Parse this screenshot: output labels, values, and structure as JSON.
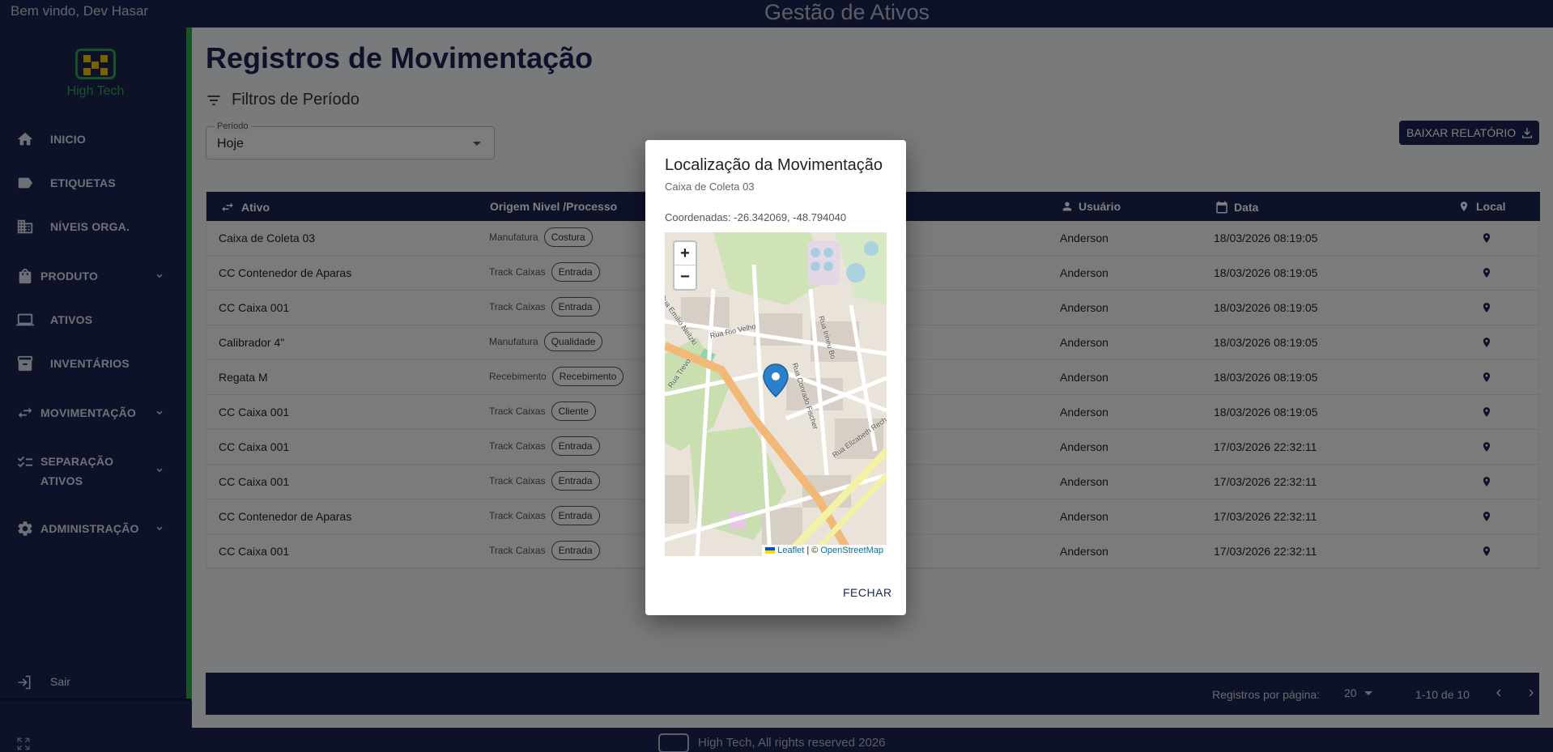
{
  "topbar": {
    "welcome": "Bem vindo, Dev Hasar",
    "app_title": "Gestão de Ativos"
  },
  "sidebar": {
    "logo_text": "High Tech",
    "items": [
      {
        "label": "INICIO",
        "icon": "home-icon",
        "has_chevron": false
      },
      {
        "label": "ETIQUETAS",
        "icon": "label-icon",
        "has_chevron": false
      },
      {
        "label": "NÍVEIS ORGA.",
        "icon": "building-icon",
        "has_chevron": false
      },
      {
        "label": "PRODUTO",
        "icon": "bag-icon",
        "has_chevron": true
      },
      {
        "label": "ATIVOS",
        "icon": "laptop-icon",
        "has_chevron": false
      },
      {
        "label": "INVENTÁRIOS",
        "icon": "archive-icon",
        "has_chevron": false
      },
      {
        "label": "MOVIMENTAÇÃO",
        "icon": "swap-icon",
        "has_chevron": true
      },
      {
        "label_line1": "SEPARAÇÃO",
        "label_line2": "ATIVOS",
        "icon": "checklist-icon",
        "has_chevron": true
      },
      {
        "label": "ADMINISTRAÇÃO",
        "icon": "gear-icon",
        "has_chevron": true
      }
    ],
    "logout": "Sair"
  },
  "main": {
    "page_title": "Registros de Movimentação",
    "filters_label": "Filtros de Período",
    "period": {
      "legend": "Período",
      "value": "Hoje"
    },
    "report_button": "BAIXAR RELATÓRIO",
    "table": {
      "headers": {
        "ativo": "Ativo",
        "origem": "Origem Nivel /Processo",
        "usuario": "Usuário",
        "data": "Data",
        "local": "Local"
      },
      "rows": [
        {
          "ativo": "Caixa de Coleta 03",
          "nivel": "Manufatura",
          "processo": "Costura",
          "usuario": "Anderson",
          "data": "18/03/2026 08:19:05"
        },
        {
          "ativo": "CC Contenedor de Aparas",
          "nivel": "Track Caixas",
          "processo": "Entrada",
          "usuario": "Anderson",
          "data": "18/03/2026 08:19:05"
        },
        {
          "ativo": "CC Caixa 001",
          "nivel": "Track Caixas",
          "processo": "Entrada",
          "usuario": "Anderson",
          "data": "18/03/2026 08:19:05"
        },
        {
          "ativo": "Calibrador 4\"",
          "nivel": "Manufatura",
          "processo": "Qualidade",
          "usuario": "Anderson",
          "data": "18/03/2026 08:19:05"
        },
        {
          "ativo": "Regata M",
          "nivel": "Recebimento",
          "processo": "Recebimento",
          "usuario": "Anderson",
          "data": "18/03/2026 08:19:05"
        },
        {
          "ativo": "CC Caixa 001",
          "nivel": "Track Caixas",
          "processo": "Cliente",
          "usuario": "Anderson",
          "data": "18/03/2026 08:19:05"
        },
        {
          "ativo": "CC Caixa 001",
          "nivel": "Track Caixas",
          "processo": "Entrada",
          "usuario": "Anderson",
          "data": "17/03/2026 22:32:11"
        },
        {
          "ativo": "CC Caixa 001",
          "nivel": "Track Caixas",
          "processo": "Entrada",
          "usuario": "Anderson",
          "data": "17/03/2026 22:32:11"
        },
        {
          "ativo": "CC Contenedor de Aparas",
          "nivel": "Track Caixas",
          "processo": "Entrada",
          "usuario": "Anderson",
          "data": "17/03/2026 22:32:11"
        },
        {
          "ativo": "CC Caixa 001",
          "nivel": "Track Caixas",
          "processo": "Entrada",
          "usuario": "Anderson",
          "data": "17/03/2026 22:32:11"
        }
      ]
    },
    "pagination": {
      "rows_per_page_label": "Registros por página:",
      "rows_per_page": "20",
      "range": "1-10 de 10"
    }
  },
  "footer": {
    "text": "High Tech, All rights reserved 2026"
  },
  "dialog": {
    "title": "Localização da Movimentação",
    "subtitle": "Caixa de Coleta 03",
    "coords": "Coordenadas: -26.342069, -48.794040",
    "map": {
      "zoom_in": "+",
      "zoom_out": "−",
      "attribution_leaflet": "Leaflet",
      "attribution_sep": "| ©",
      "attribution_osm": "OpenStreetMap",
      "streets": [
        "Rua Emílio Neitzki",
        "Rua Rio Velho",
        "Rua Trevo",
        "Rua Conrado Fischer",
        "Rua Elizabeth Rech",
        "Rua Irineu Bo"
      ]
    },
    "close": "FECHAR"
  },
  "colors": {
    "navy": "#1b2553",
    "green": "#2fa84a",
    "yellow": "#f2c200"
  }
}
